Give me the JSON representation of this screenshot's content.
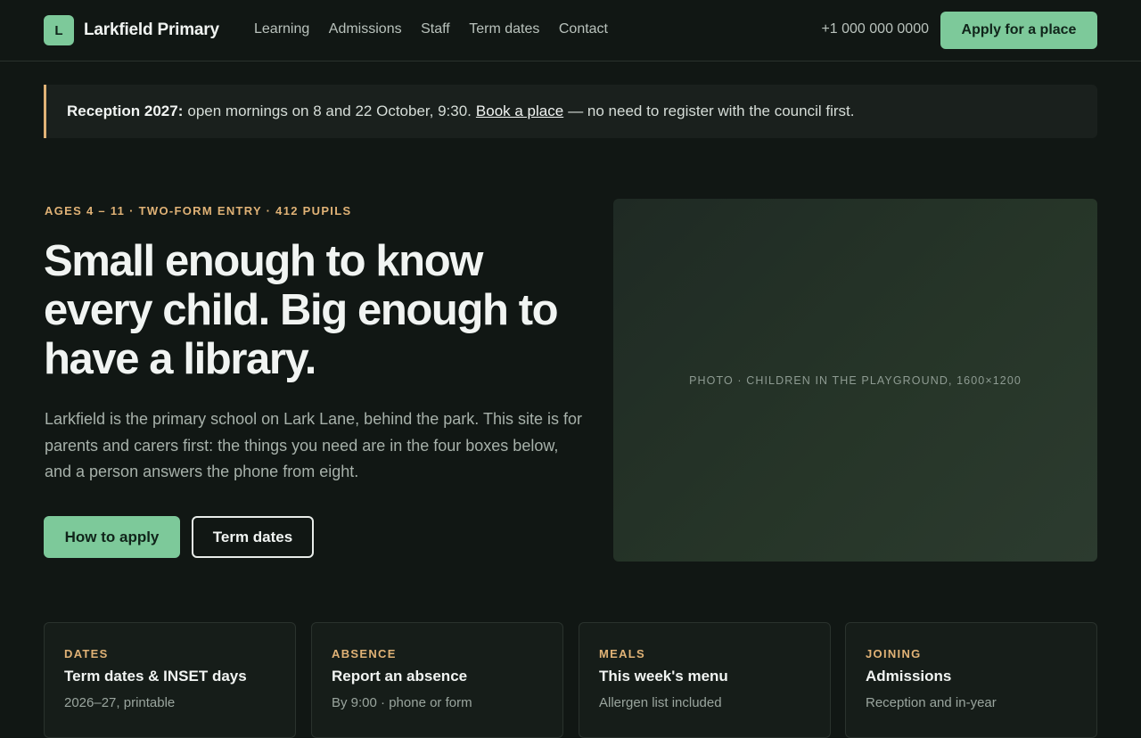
{
  "header": {
    "logo_letter": "L",
    "school_name": "Larkfield Primary",
    "nav": [
      "Learning",
      "Admissions",
      "Staff",
      "Term dates",
      "Contact"
    ],
    "phone": "+1 000 000 0000",
    "apply_label": "Apply for a place"
  },
  "notice": {
    "lead": "Reception 2027:",
    "text": "open mornings on 8 and 22 October, 9:30.",
    "link": "Book a place",
    "tail": "— no need to register with the council first."
  },
  "hero": {
    "eyebrow": "AGES 4 – 11 · TWO-FORM ENTRY · 412 PUPILS",
    "title": "Small enough to know every child. Big enough to have a library.",
    "text": "Larkfield is the primary school on Lark Lane, behind the park. This site is for parents and carers first: the things you need are in the four boxes below, and a person answers the phone from eight.",
    "primary_button": "How to apply",
    "secondary_button": "Term dates",
    "photo_caption": "PHOTO · CHILDREN IN THE PLAYGROUND, 1600×1200"
  },
  "cards": [
    {
      "tag": "DATES",
      "title": "Term dates & INSET days",
      "sub": "2026–27, printable"
    },
    {
      "tag": "ABSENCE",
      "title": "Report an absence",
      "sub": "By 9:00 · phone or form"
    },
    {
      "tag": "MEALS",
      "title": "This week's menu",
      "sub": "Allergen list included"
    },
    {
      "tag": "JOINING",
      "title": "Admissions",
      "sub": "Reception and in-year"
    }
  ],
  "colors": {
    "background": "#111714",
    "accent_green": "#7dc99a",
    "accent_amber": "#e0b276"
  }
}
